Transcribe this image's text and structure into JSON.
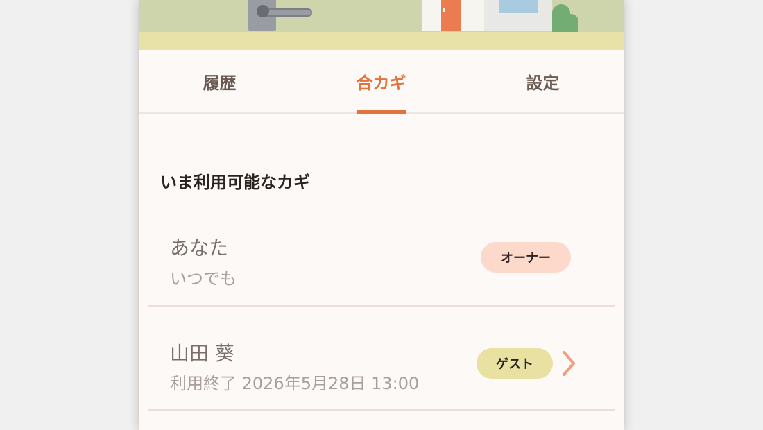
{
  "tabs": [
    {
      "label": "履歴",
      "active": false
    },
    {
      "label": "合カギ",
      "active": true
    },
    {
      "label": "設定",
      "active": false
    }
  ],
  "section_title": "いま利用可能なカギ",
  "keys": [
    {
      "name": "あなた",
      "detail": "いつでも",
      "badge": "オーナー",
      "badge_color": "#fdd9cc",
      "has_chevron": false
    },
    {
      "name": "山田 葵",
      "detail": "利用終了 2026年5月28日 13:00",
      "badge": "ゲスト",
      "badge_color": "#e8e1a2",
      "has_chevron": true
    }
  ],
  "colors": {
    "accent": "#e4723f",
    "chevron": "#f19d80"
  }
}
